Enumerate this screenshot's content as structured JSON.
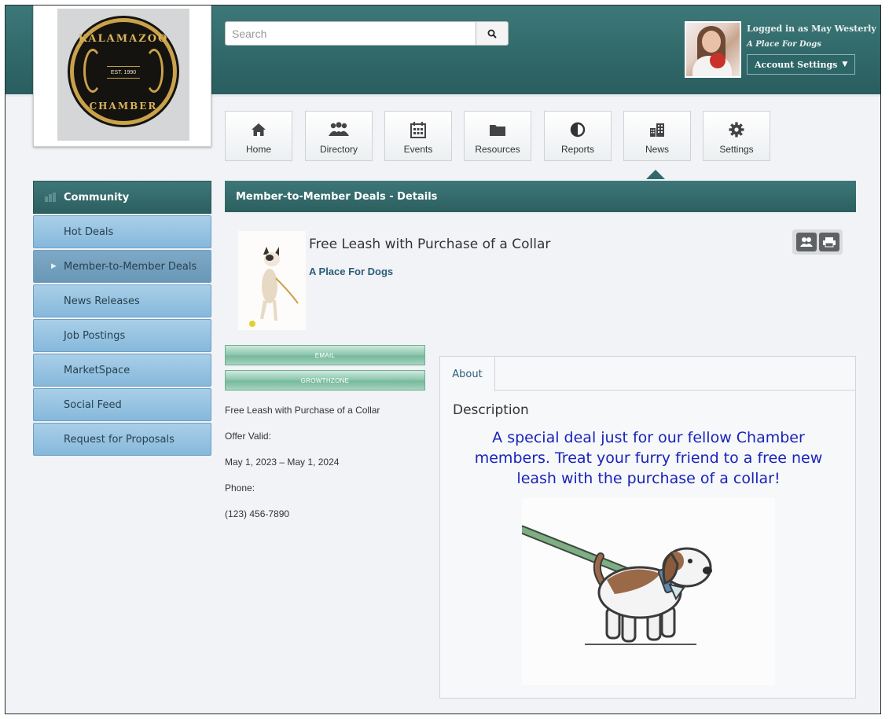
{
  "logo": {
    "ring_top": "KALAMAZOO",
    "ring_bottom": "CHAMBER",
    "est": "EST. 1990"
  },
  "search": {
    "placeholder": "Search",
    "icon": "search-icon"
  },
  "user": {
    "logged_in_text": "Logged in as May Westerly",
    "organization": "A Place For Dogs",
    "account_settings_label": "Account Settings"
  },
  "nav": {
    "tiles": [
      {
        "label": "Home",
        "icon": "home-icon"
      },
      {
        "label": "Directory",
        "icon": "people-icon"
      },
      {
        "label": "Events",
        "icon": "calendar-icon"
      },
      {
        "label": "Resources",
        "icon": "folder-icon"
      },
      {
        "label": "Reports",
        "icon": "pie-chart-icon"
      },
      {
        "label": "News",
        "icon": "buildings-icon"
      },
      {
        "label": "Settings",
        "icon": "gear-icon"
      }
    ],
    "active": "News"
  },
  "sidebar": {
    "header": "Community",
    "items": [
      {
        "label": "Hot Deals"
      },
      {
        "label": "Member-to-Member Deals"
      },
      {
        "label": "News Releases"
      },
      {
        "label": "Job Postings"
      },
      {
        "label": "MarketSpace"
      },
      {
        "label": "Social Feed"
      },
      {
        "label": "Request for Proposals"
      }
    ],
    "active_item": "Member-to-Member Deals"
  },
  "content": {
    "header": "Member-to-Member Deals - Details",
    "deal_title": "Free Leash with Purchase of a Collar",
    "organization": "A Place For Dogs",
    "email_button": "EMAIL",
    "growthzone_button": "GROWTHZONE",
    "info": {
      "title": "Free Leash with Purchase of a Collar",
      "offer_label": "Offer Valid:",
      "offer_value": "May 1, 2023 – May 1, 2024",
      "phone_label": "Phone:",
      "phone_value": "(123) 456-7890"
    }
  },
  "about": {
    "tab_label": "About",
    "heading": "Description",
    "text": "A special deal just for our fellow Chamber members. Treat your furry friend to a free new leash with the purchase of a collar!"
  },
  "colors": {
    "header_teal": "#2e6566",
    "sidebar_blue": "#86b8db",
    "description_text": "#1a23b8"
  }
}
